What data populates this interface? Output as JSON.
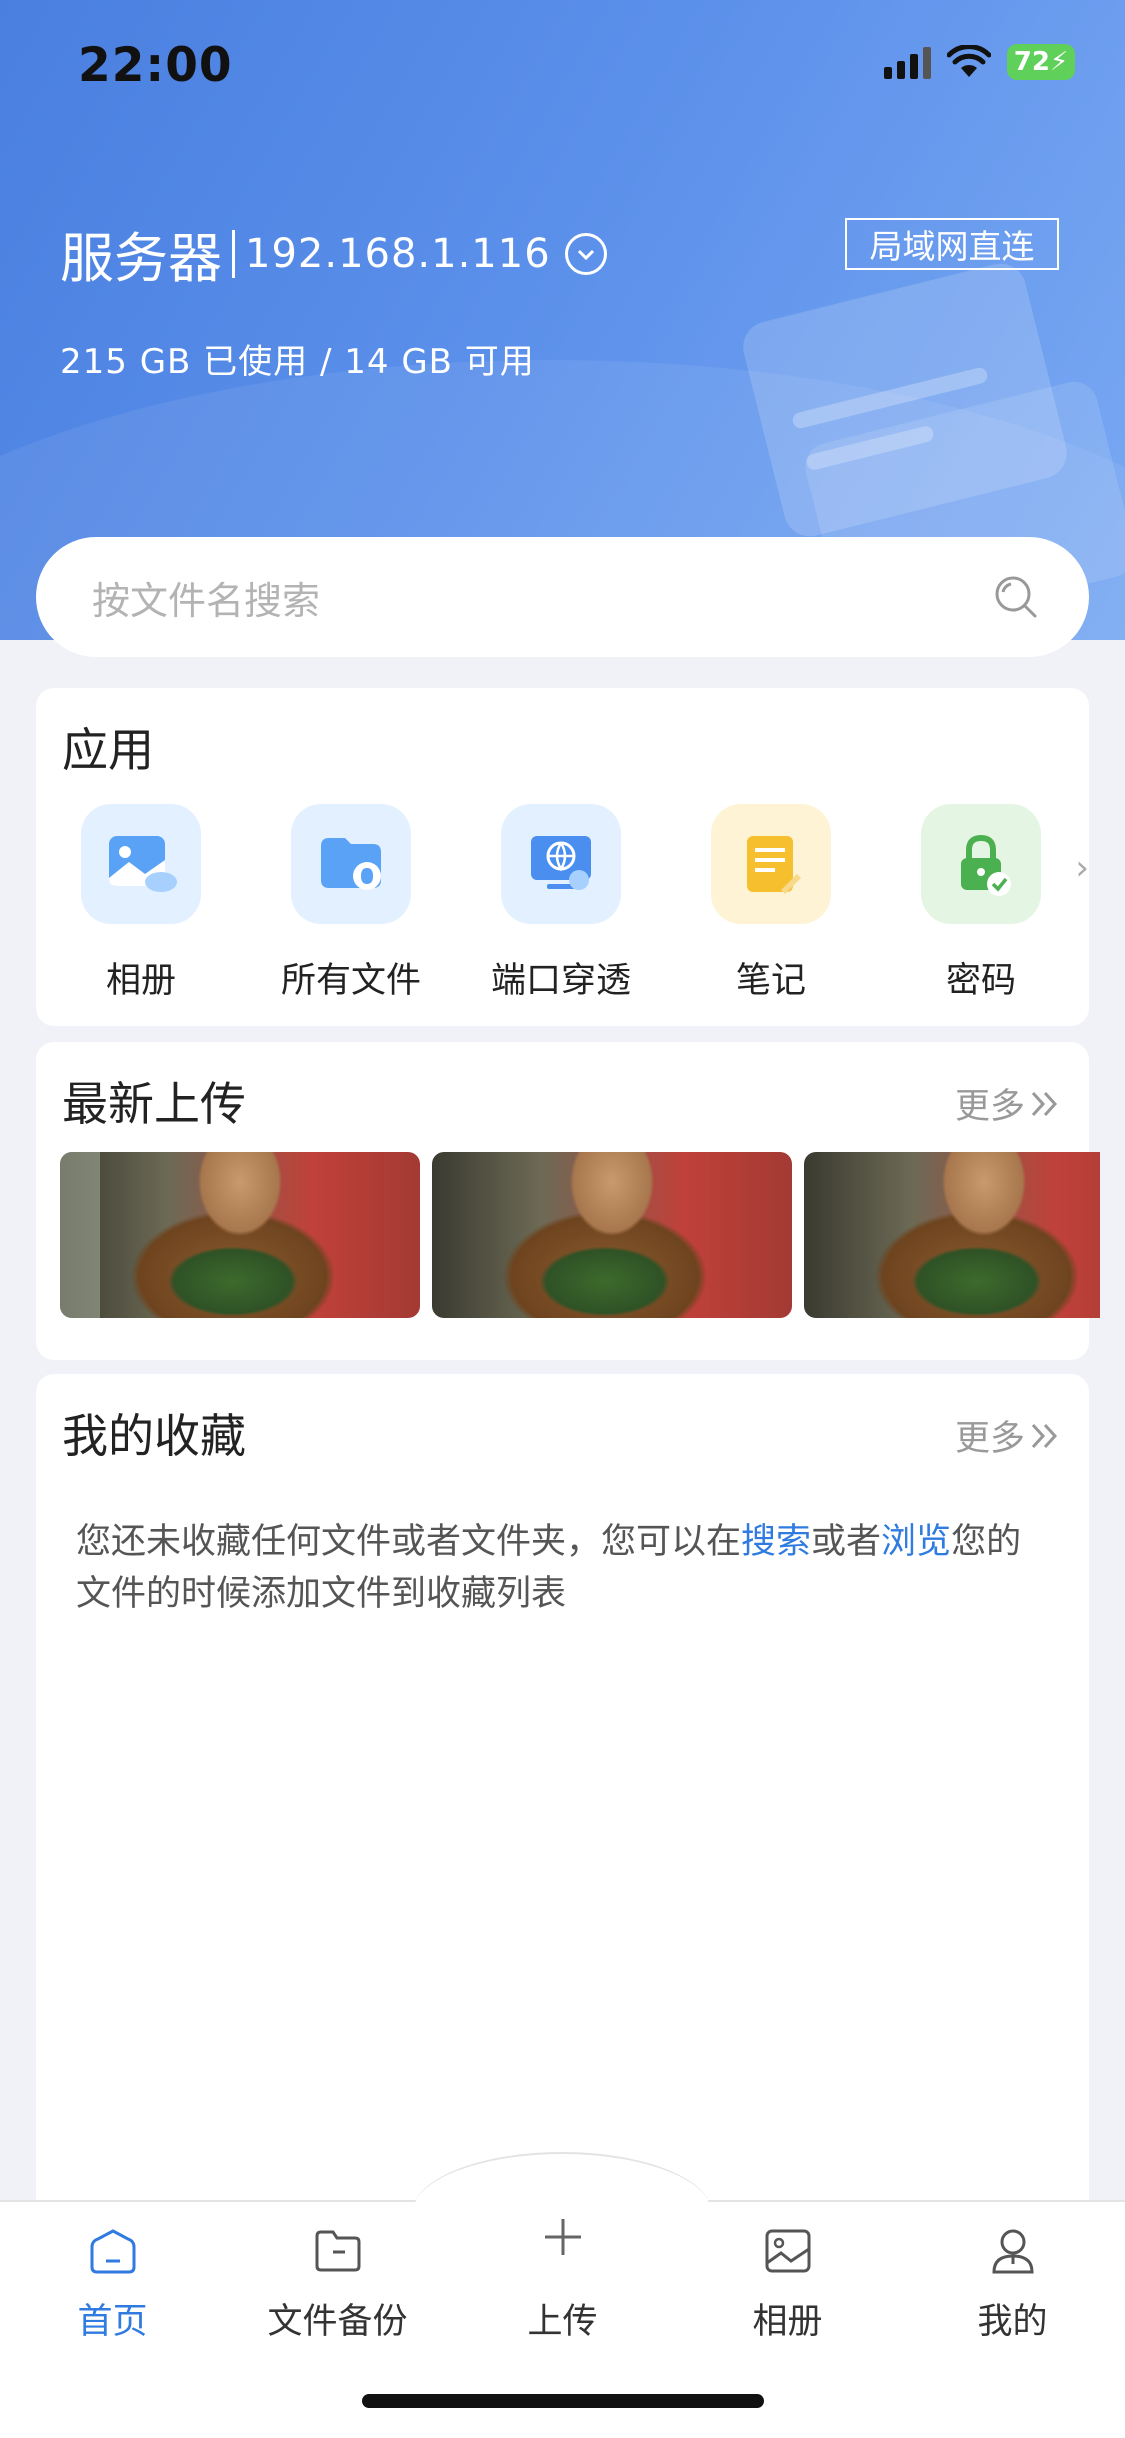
{
  "status_bar": {
    "time": "22:00",
    "battery": "72"
  },
  "header": {
    "server_name": "服务器",
    "server_ip": "192.168.1.116",
    "connection_mode": "局域网直连",
    "storage": "215 GB 已使用 / 14 GB 可用"
  },
  "search": {
    "placeholder": "按文件名搜索"
  },
  "apps": {
    "title": "应用",
    "items": [
      {
        "label": "相册",
        "icon": "photo-album-icon",
        "bg": "#e3f0ff"
      },
      {
        "label": "所有文件",
        "icon": "folder-apple-icon",
        "bg": "#e3f0ff"
      },
      {
        "label": "端口穿透",
        "icon": "globe-monitor-icon",
        "bg": "#e3f0ff"
      },
      {
        "label": "笔记",
        "icon": "note-pencil-icon",
        "bg": "#fff3d6"
      },
      {
        "label": "密码",
        "icon": "lock-check-icon",
        "bg": "#e5f5e4"
      }
    ]
  },
  "recent": {
    "title": "最新上传",
    "more": "更多"
  },
  "favorites": {
    "title": "我的收藏",
    "more": "更多",
    "empty_text_1": "您还未收藏任何文件或者文件夹，您可以在",
    "link_search": "搜索",
    "empty_text_2": "或者",
    "link_browse": "浏览",
    "empty_text_3": "您的文件的时候添加文件到收藏列表"
  },
  "tabbar": {
    "items": [
      {
        "label": "首页",
        "icon": "home-icon"
      },
      {
        "label": "文件备份",
        "icon": "folder-icon"
      },
      {
        "label": "上传",
        "icon": "plus-icon"
      },
      {
        "label": "相册",
        "icon": "image-icon"
      },
      {
        "label": "我的",
        "icon": "user-icon"
      }
    ],
    "active": "首页",
    "accent": "#2f7be0"
  }
}
